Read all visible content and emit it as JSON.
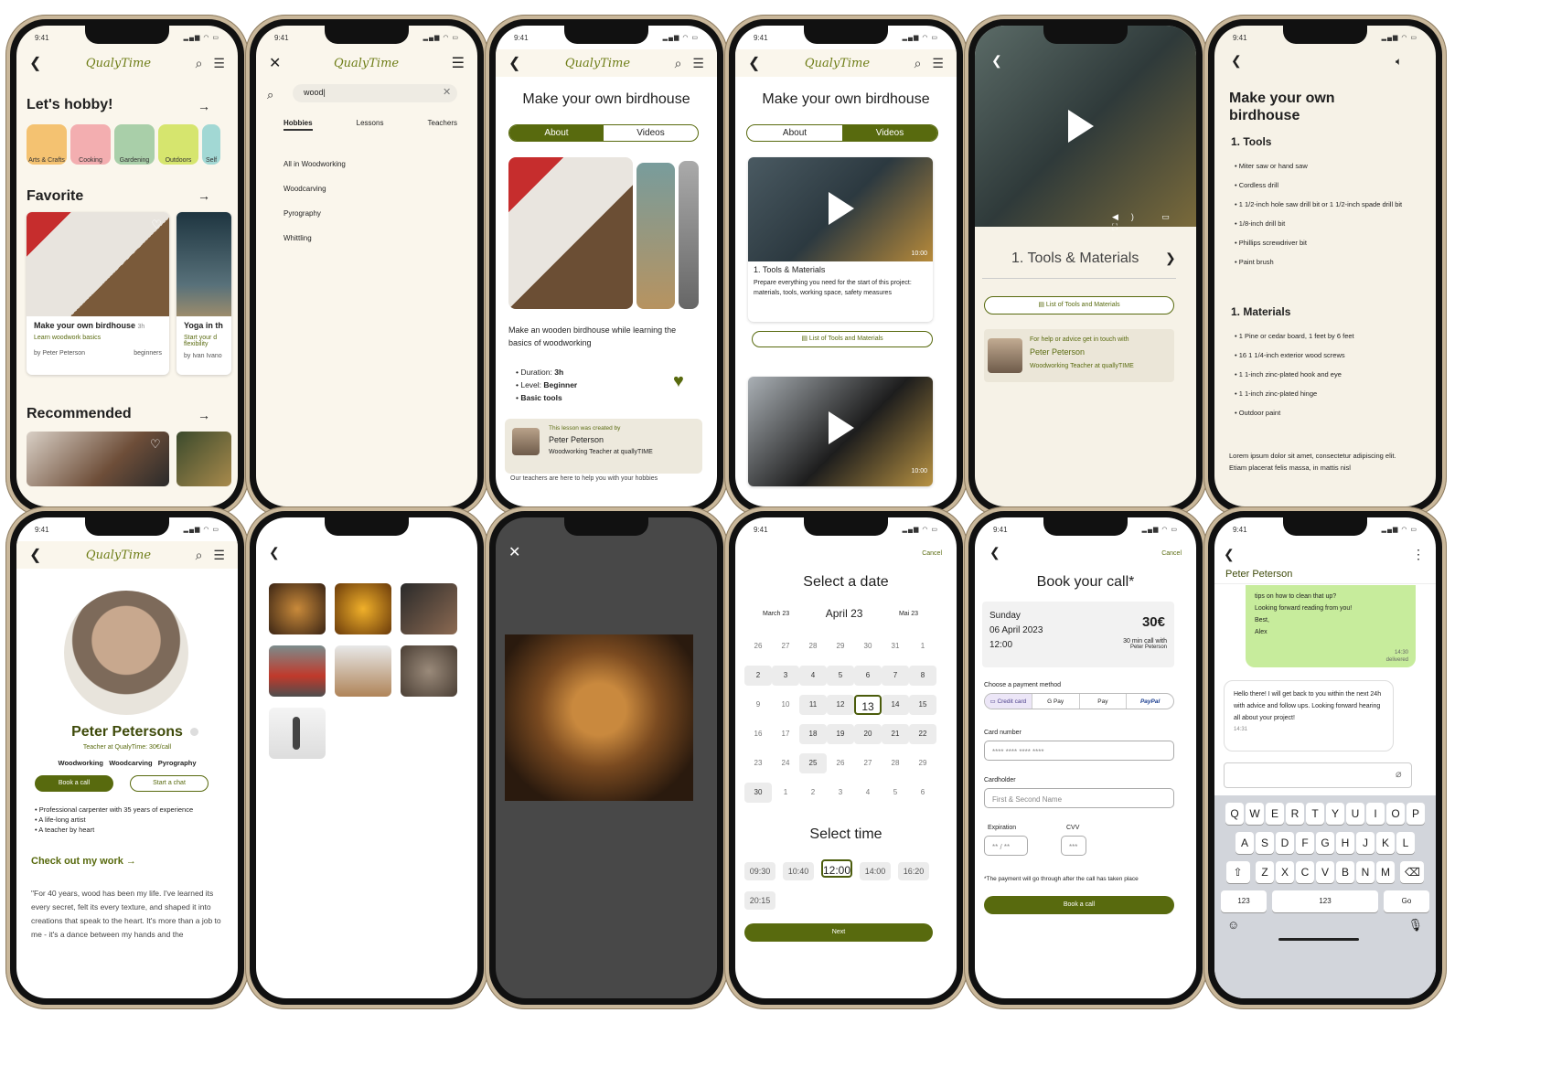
{
  "app": {
    "logo": "QualyTime",
    "time": "9:41"
  },
  "s1": {
    "title": "Let's hobby!",
    "categories": [
      "Arts & Crafts",
      "Cooking",
      "Gardening",
      "Outdoors",
      "Self"
    ],
    "favorite": "Favorite",
    "card1": {
      "title": "Make your own birdhouse",
      "dur": "3h",
      "sub": "Learn woodwork basics",
      "by": "by Peter Peterson",
      "level": "beginners"
    },
    "card2": {
      "title": "Yoga in th",
      "sub": "Start your d flexibility",
      "by": "by Ivan Ivano"
    },
    "recommended": "Recommended"
  },
  "s2": {
    "query": "wood",
    "tabs": [
      "Hobbies",
      "Lessons",
      "Teachers"
    ],
    "results": [
      "All in Woodworking",
      "Woodcarving",
      "Pyrography",
      "Whittling"
    ]
  },
  "s3": {
    "title": "Make your own birdhouse",
    "tab_about": "About",
    "tab_videos": "Videos",
    "desc": "Make an wooden birdhouse while learning the basics of woodworking",
    "duration_label": "Duration:",
    "duration": "3h",
    "level_label": "Level:",
    "level": "Beginner",
    "tools": "Basic tools",
    "created_by": "This lesson was created by",
    "teacher": "Peter Peterson",
    "teacher_role": "Woodworking Teacher at quallyTIME",
    "footer": "Our teachers are here to help you with your hobbies"
  },
  "s4": {
    "title": "Make your own birdhouse",
    "video1_title": "1. Tools & Materials",
    "video1_desc": "Prepare everything you need for the start of this project: materials, tools, working space, safety measures",
    "duration": "10:00",
    "list_btn": "List of Tools and Materials",
    "duration2": "10:00"
  },
  "s5": {
    "chapter": "1. Tools & Materials",
    "list_btn": "List of Tools and Materials",
    "help": "For help or advice get in touch with",
    "teacher": "Peter Peterson",
    "role": "Woodworking Teacher at quallyTIME"
  },
  "s6": {
    "title": "Make your own birdhouse",
    "tools_h": "1. Tools",
    "tools": [
      "Miter saw or hand saw",
      "Cordless drill",
      "1 1/2-inch hole saw drill bit or 1 1/2-inch spade drill bit",
      "1/8-inch drill bit",
      "Phillips screwdriver bit",
      "Paint brush"
    ],
    "materials_h": "1. Materials",
    "materials": [
      "1 Pine or cedar board, 1 feet by 6 feet",
      "16 1 1/4-inch exterior wood screws",
      "1 1-inch zinc-plated hook and eye",
      "1 1-inch zinc-plated hinge",
      "Outdoor paint"
    ],
    "lorem": "Lorem ipsum dolor sit amet, consectetur adipiscing elit. Etiam placerat felis massa, in mattis nisl"
  },
  "s7": {
    "name": "Peter Petersons",
    "sub": "Teacher at QualyTime: 30€/call",
    "skills": "Woodworking   Woodcarving   Pyrography",
    "book": "Book a call",
    "chat": "Start a chat",
    "bullets": [
      "Professional carpenter with 35 years of experience",
      "A life-long artist",
      "A teacher by heart"
    ],
    "work": "Check out my work",
    "quote": "\"For 40 years, wood has been my life. I've learned its every secret, felt its every texture, and shaped it into creations that speak to the heart. It's more than a job to me - it's a dance between my hands and the"
  },
  "s10": {
    "cancel": "Cancel",
    "title": "Select a date",
    "prev": "March 23",
    "cur": "April 23",
    "next": "Mai 23",
    "days": [
      "26",
      "27",
      "28",
      "29",
      "30",
      "31",
      "1",
      "2",
      "3",
      "4",
      "5",
      "6",
      "7",
      "8",
      "9",
      "10",
      "11",
      "12",
      "13",
      "14",
      "15",
      "16",
      "17",
      "18",
      "19",
      "20",
      "21",
      "22",
      "23",
      "24",
      "25",
      "26",
      "27",
      "28",
      "29",
      "30",
      "1",
      "2",
      "3",
      "4",
      "5",
      "6"
    ],
    "time_title": "Select time",
    "times": [
      "09:30",
      "10:40",
      "12:00",
      "14:00",
      "16:20",
      "20:15"
    ],
    "next_btn": "Next"
  },
  "s11": {
    "cancel": "Cancel",
    "title": "Book your call*",
    "day": "Sunday",
    "date": "06 April 2023",
    "time": "12:00",
    "price": "30€",
    "dur": "30 min call with",
    "with": "Peter Peterson",
    "pay_label": "Choose a payment method",
    "methods": [
      "Credit card",
      "G Pay",
      "Pay",
      "PayPal"
    ],
    "card_label": "Card number",
    "card_ph": "**** **** **** ****",
    "holder_label": "Cardholder",
    "holder_ph": "First & Second Name",
    "exp_label": "Expiration",
    "exp_ph": "** / **",
    "cvv_label": "CVV",
    "cvv_ph": "***",
    "note": "*The payment will go through after the call has taken place",
    "book": "Book a call"
  },
  "s12": {
    "name": "Peter Peterson",
    "msg1": "tips on how to clean that up?\nLooking forward reading from you!\nBest,\nAlex",
    "msg1_time": "14:30",
    "msg1_status": "delivered",
    "msg2": "Hello there! I will get back to you within the next 24h with advice and follow ups. Looking forward hearing all about your project!",
    "msg2_time": "14:31",
    "row1": [
      "Q",
      "W",
      "E",
      "R",
      "T",
      "Y",
      "U",
      "I",
      "O",
      "P"
    ],
    "row2": [
      "A",
      "S",
      "D",
      "F",
      "G",
      "H",
      "J",
      "K",
      "L"
    ],
    "row3": [
      "Z",
      "X",
      "C",
      "V",
      "B",
      "N",
      "M"
    ],
    "k123": "123",
    "kspace": "123",
    "kgo": "Go"
  }
}
